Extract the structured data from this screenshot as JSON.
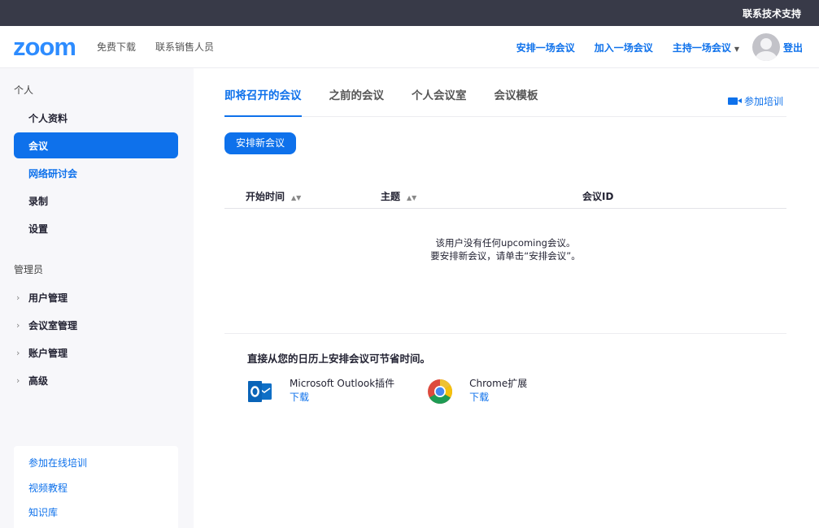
{
  "topbar": {
    "support": "联系技术支持"
  },
  "header": {
    "logo": "zoom",
    "nav": [
      "免费下载",
      "联系销售人员"
    ],
    "schedule": "安排一场会议",
    "join": "加入一场会议",
    "host": "主持一场会议",
    "logout": "登出"
  },
  "sidebar": {
    "personal_title": "个人",
    "personal_items": [
      "个人资料",
      "会议",
      "网络研讨会",
      "录制",
      "设置"
    ],
    "admin_title": "管理员",
    "admin_items": [
      "用户管理",
      "会议室管理",
      "账户管理",
      "高级"
    ],
    "help_links": [
      "参加在线培训",
      "视频教程",
      "知识库"
    ]
  },
  "main": {
    "tabs": [
      "即将召开的会议",
      "之前的会议",
      "个人会议室",
      "会议模板"
    ],
    "training": "参加培训",
    "schedule_button": "安排新会议",
    "table_headers": [
      "开始时间",
      "主题",
      "会议ID"
    ],
    "empty_line1": "该用户没有任何upcoming会议。",
    "empty_line2": "要安排新会议，请单击“安排会议”。",
    "calendar_title": "直接从您的日历上安排会议可节省时间。",
    "plugins": [
      {
        "name": "Microsoft Outlook插件",
        "link": "下载",
        "icon": "outlook-icon"
      },
      {
        "name": "Chrome扩展",
        "link": "下载",
        "icon": "chrome-icon"
      }
    ]
  },
  "colors": {
    "accent": "#0e71eb",
    "topbar": "#383a48",
    "sidebar": "#f7f7fa"
  }
}
